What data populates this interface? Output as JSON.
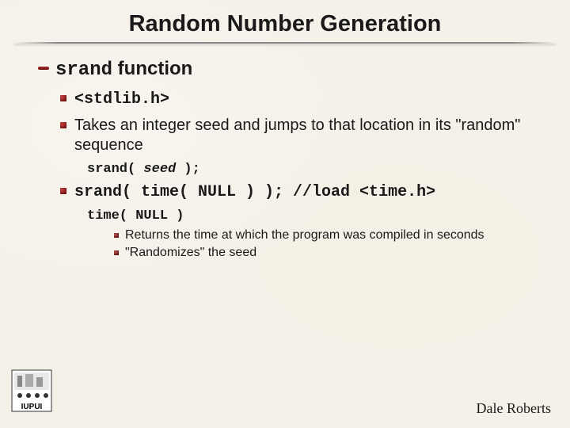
{
  "title": "Random Number Generation",
  "section": {
    "heading_code": "srand",
    "heading_rest": " function",
    "items": [
      {
        "kind": "l2",
        "mono": true,
        "text": "<stdlib.h>"
      },
      {
        "kind": "l2",
        "mono": false,
        "text": "Takes an integer seed and jumps to that location in its \"random\" sequence"
      },
      {
        "kind": "l3_code",
        "prefix": "srand( ",
        "italic": "seed",
        "suffix": " );"
      },
      {
        "kind": "l2",
        "mono": true,
        "text": "srand( time( NULL ) );  //load <time.h>"
      },
      {
        "kind": "l3b_code",
        "text": "time( NULL )"
      },
      {
        "kind": "l4",
        "text": "Returns the time at which the program was compiled in seconds"
      },
      {
        "kind": "l4",
        "text": "\"Randomizes\" the seed"
      }
    ]
  },
  "footer": {
    "author": "Dale Roberts",
    "logo_label": "IUPUI"
  }
}
